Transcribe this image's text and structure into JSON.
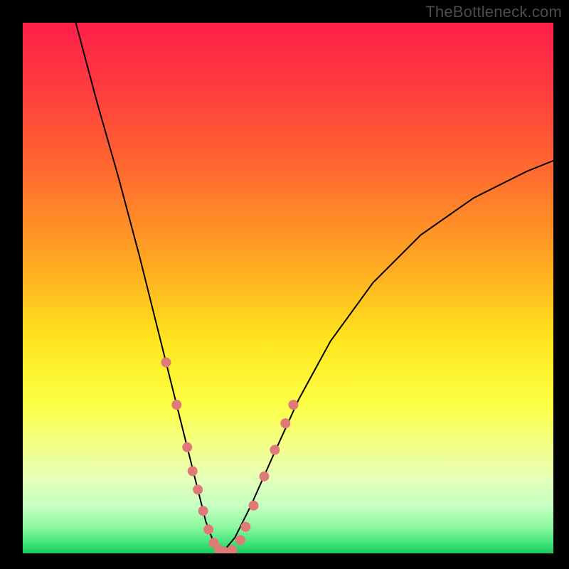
{
  "watermark": "TheBottleneck.com",
  "chart_data": {
    "type": "line",
    "title": "",
    "xlabel": "",
    "ylabel": "",
    "xlim": [
      0,
      100
    ],
    "ylim": [
      0,
      100
    ],
    "grid": false,
    "legend": false,
    "series": [
      {
        "name": "curve-left",
        "x": [
          10,
          14,
          18,
          22,
          25,
          27,
          29,
          31,
          33,
          34.5,
          36,
          37.5
        ],
        "y": [
          100,
          85,
          71,
          56,
          44,
          36,
          28,
          20,
          12,
          6,
          2,
          0
        ]
      },
      {
        "name": "curve-right",
        "x": [
          37.5,
          40,
          43,
          47,
          52,
          58,
          66,
          75,
          85,
          95,
          100
        ],
        "y": [
          0,
          3,
          9,
          18,
          29,
          40,
          51,
          60,
          67,
          72,
          74
        ]
      }
    ],
    "markers": [
      {
        "x": 27.0,
        "y": 36.0,
        "r": 7
      },
      {
        "x": 29.0,
        "y": 28.0,
        "r": 7
      },
      {
        "x": 31.0,
        "y": 20.0,
        "r": 7
      },
      {
        "x": 32.0,
        "y": 15.5,
        "r": 7
      },
      {
        "x": 33.0,
        "y": 12.0,
        "r": 7
      },
      {
        "x": 34.0,
        "y": 8.0,
        "r": 7
      },
      {
        "x": 35.0,
        "y": 4.5,
        "r": 7
      },
      {
        "x": 36.0,
        "y": 2.0,
        "r": 7
      },
      {
        "x": 37.0,
        "y": 0.7,
        "r": 7
      },
      {
        "x": 38.0,
        "y": 0.3,
        "r": 7
      },
      {
        "x": 39.5,
        "y": 0.6,
        "r": 7
      },
      {
        "x": 41.0,
        "y": 2.5,
        "r": 7
      },
      {
        "x": 42.0,
        "y": 5.0,
        "r": 7
      },
      {
        "x": 43.5,
        "y": 9.0,
        "r": 7
      },
      {
        "x": 45.5,
        "y": 14.5,
        "r": 7
      },
      {
        "x": 47.5,
        "y": 19.5,
        "r": 7
      },
      {
        "x": 49.5,
        "y": 24.5,
        "r": 7
      },
      {
        "x": 51.0,
        "y": 28.0,
        "r": 7
      }
    ],
    "gradient_stops": [
      {
        "offset": 0.0,
        "color": "#ff1f4b"
      },
      {
        "offset": 0.12,
        "color": "#ff3b3f"
      },
      {
        "offset": 0.28,
        "color": "#ff6a2f"
      },
      {
        "offset": 0.45,
        "color": "#ffa722"
      },
      {
        "offset": 0.6,
        "color": "#ffe61f"
      },
      {
        "offset": 0.72,
        "color": "#fdff45"
      },
      {
        "offset": 0.8,
        "color": "#f3ff8a"
      },
      {
        "offset": 0.86,
        "color": "#e4ffb8"
      },
      {
        "offset": 0.91,
        "color": "#c6ffc2"
      },
      {
        "offset": 0.95,
        "color": "#8cf8a0"
      },
      {
        "offset": 0.98,
        "color": "#43e57a"
      },
      {
        "offset": 1.0,
        "color": "#18c95c"
      }
    ],
    "marker_color": "#e07a78",
    "curve_color": "#000000"
  }
}
